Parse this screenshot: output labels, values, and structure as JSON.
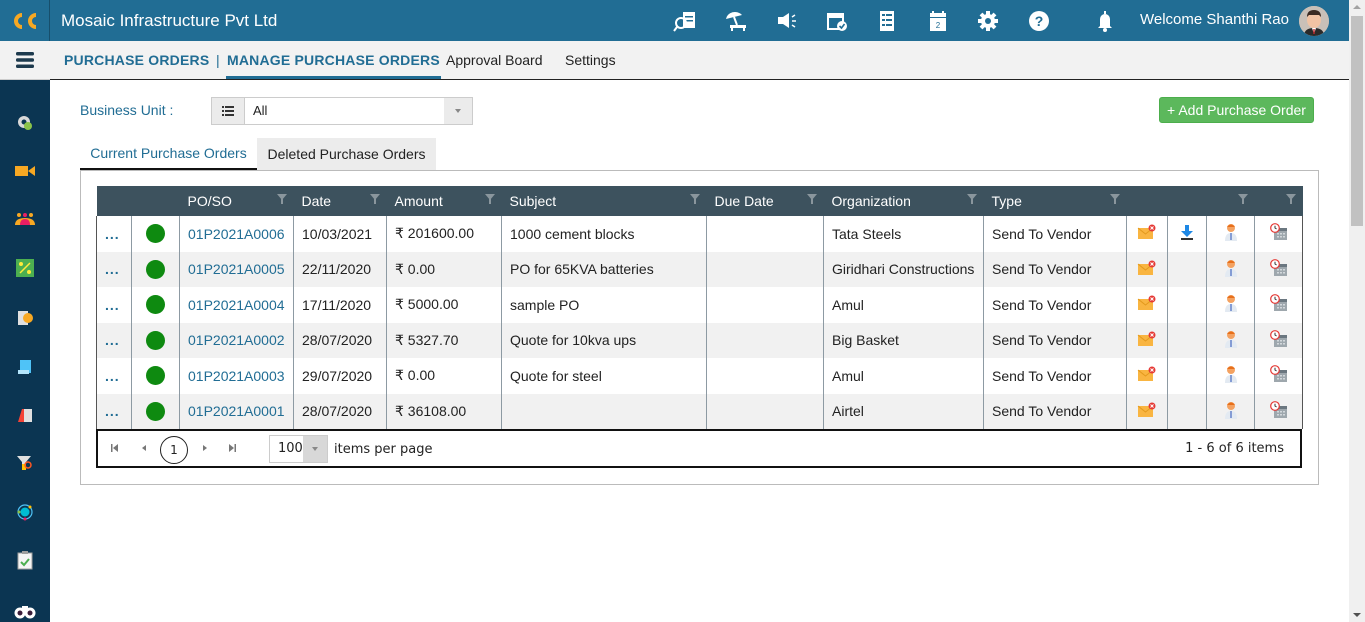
{
  "header": {
    "company": "Mosaic Infrastructure Pvt Ltd",
    "welcome": "Welcome Shanthi Rao",
    "icons": [
      "search-document-icon",
      "leave-beach-icon",
      "announcement-megaphone-icon",
      "calendar-check-icon",
      "checklist-icon",
      "calendar-icon",
      "settings-gear-icon",
      "help-icon",
      "notification-bell-icon"
    ]
  },
  "subnav": {
    "primary": "PURCHASE ORDERS",
    "separator": "|",
    "items": [
      "MANAGE PURCHASE ORDERS",
      "Approval Board",
      "Settings"
    ]
  },
  "sidebar": {
    "icons": [
      "dashboard-settings-icon",
      "video-icon",
      "team-icon",
      "module-grid-icon",
      "report-icon",
      "notes-icon",
      "document-icon",
      "filter-search-icon",
      "network-icon",
      "clipboard-check-icon",
      "binoculars-icon"
    ]
  },
  "filters": {
    "business_unit_label": "Business Unit :",
    "business_unit_value": "All"
  },
  "actions": {
    "add_label": "+ Add Purchase Order"
  },
  "tabs": [
    "Current Purchase Orders",
    "Deleted Purchase Orders"
  ],
  "table": {
    "columns": [
      "",
      "",
      "PO/SO",
      "Date",
      "Amount",
      "Subject",
      "Due Date",
      "Organization",
      "Type",
      "",
      "",
      "",
      ""
    ],
    "rows": [
      {
        "menu": "...",
        "status": "active",
        "po": "01P2021A0006",
        "date": "10/03/2021",
        "amount": "₹ 201600.00",
        "subject": "1000 cement blocks",
        "due_date": "",
        "organization": "Tata Steels",
        "type": "Send To Vendor",
        "download": true
      },
      {
        "menu": "...",
        "status": "active",
        "po": "01P2021A0005",
        "date": "22/11/2020",
        "amount": "₹ 0.00",
        "subject": "PO for 65KVA batteries",
        "due_date": "",
        "organization": "Giridhari Constructions",
        "type": "Send To Vendor",
        "download": false
      },
      {
        "menu": "...",
        "status": "active",
        "po": "01P2021A0004",
        "date": "17/11/2020",
        "amount": "₹ 5000.00",
        "subject": "sample PO",
        "due_date": "",
        "organization": "Amul",
        "type": "Send To Vendor",
        "download": false
      },
      {
        "menu": "...",
        "status": "active",
        "po": "01P2021A0002",
        "date": "28/07/2020",
        "amount": "₹ 5327.70",
        "subject": "Quote for 10kva ups",
        "due_date": "",
        "organization": "Big Basket",
        "type": "Send To Vendor",
        "download": false
      },
      {
        "menu": "...",
        "status": "active",
        "po": "01P2021A0003",
        "date": "29/07/2020",
        "amount": "₹ 0.00",
        "subject": "Quote for steel",
        "due_date": "",
        "organization": "Amul",
        "type": "Send To Vendor",
        "download": false
      },
      {
        "menu": "...",
        "status": "active",
        "po": "01P2021A0001",
        "date": "28/07/2020",
        "amount": "₹ 36108.00",
        "subject": "",
        "due_date": "",
        "organization": "Airtel",
        "type": "Send To Vendor",
        "download": false
      }
    ]
  },
  "pager": {
    "current_page": "1",
    "page_size": "100",
    "items_per_page_label": "items per page",
    "info": "1 - 6 of 6 items"
  },
  "colors": {
    "header": "#216d94",
    "sidebar": "#0b3552",
    "grid_header": "#3d525e",
    "add_button": "#5cb85c",
    "status_active": "#0e8a10"
  }
}
